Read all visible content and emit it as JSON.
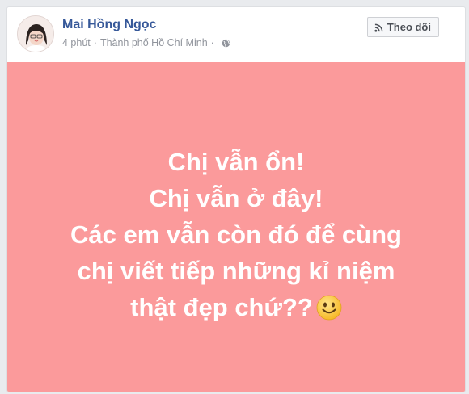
{
  "post": {
    "author_name": "Mai Hồng Ngọc",
    "time": "4 phút",
    "separator": "·",
    "location": "Thành phố Hồ Chí Minh",
    "privacy_icon": "globe-icon",
    "follow_label": "Theo dõi",
    "follow_icon": "rss-icon",
    "background_color": "#fb9a9b",
    "text_color": "#ffffff",
    "status_lines": [
      "Chị vẫn ổn!",
      "Chị vẫn ở đây!",
      "Các em vẫn còn đó để cùng",
      "chị viết tiếp những kỉ niệm",
      "thật đẹp chứ??"
    ],
    "emoji": "smile-emoji-icon"
  }
}
